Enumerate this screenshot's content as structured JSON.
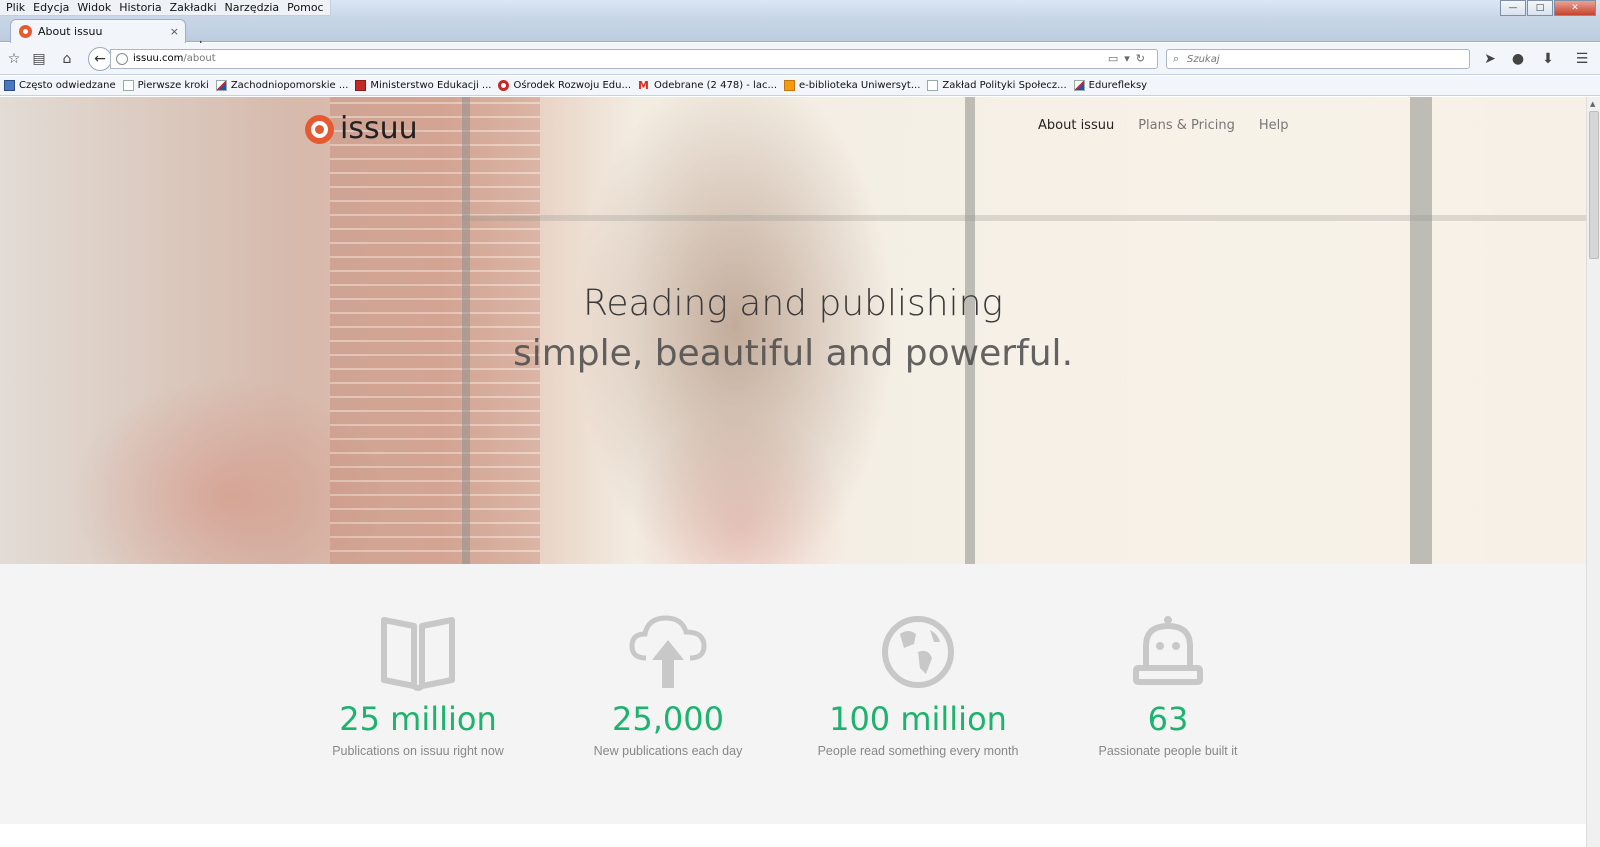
{
  "window": {
    "menu": [
      "Plik",
      "Edycja",
      "Widok",
      "Historia",
      "Zakładki",
      "Narzędzia",
      "Pomoc"
    ],
    "controls": {
      "minimize": "—",
      "maximize": "□",
      "close": "✕"
    }
  },
  "tabs": [
    {
      "label": "About issuu",
      "close": "×",
      "active": true
    }
  ],
  "new_tab_label": "+",
  "navbar": {
    "url_host": "issuu.com",
    "url_path": "/about",
    "search_placeholder": "Szukaj"
  },
  "bookmarks": [
    {
      "label": "Często odwiedzane",
      "icon": "blue"
    },
    {
      "label": "Pierwsze kroki",
      "icon": "page"
    },
    {
      "label": "Zachodniopomorskie ...",
      "icon": "flag"
    },
    {
      "label": "Ministerstwo Edukacji ...",
      "icon": "red"
    },
    {
      "label": "Ośrodek Rozwoju Edu...",
      "icon": "target"
    },
    {
      "label": "Odebrane (2 478) - lac...",
      "icon": "gmail"
    },
    {
      "label": "e-biblioteka Uniwersyt...",
      "icon": "orange"
    },
    {
      "label": "Zakład Polityki Społecz...",
      "icon": "page"
    },
    {
      "label": "Edurefleksy",
      "icon": "flag"
    }
  ],
  "site": {
    "logo_text": "issuu",
    "nav": [
      {
        "label": "About issuu",
        "active": true
      },
      {
        "label": "Plans & Pricing",
        "active": false
      },
      {
        "label": "Help",
        "active": false
      }
    ],
    "headline_line1": "Reading and publishing",
    "headline_line2": "simple, beautiful and powerful."
  },
  "stats": [
    {
      "icon": "book-icon",
      "value": "25 million",
      "label": "Publications on issuu right now"
    },
    {
      "icon": "cloud-upload-icon",
      "value": "25,000",
      "label": "New publications each day"
    },
    {
      "icon": "globe-icon",
      "value": "100 million",
      "label": "People read something every month"
    },
    {
      "icon": "robot-icon",
      "value": "63",
      "label": "Passionate people built it"
    }
  ],
  "colors": {
    "accent_green": "#1db26d",
    "brand_orange": "#e65a32",
    "icon_gray": "#c8c8c8"
  }
}
